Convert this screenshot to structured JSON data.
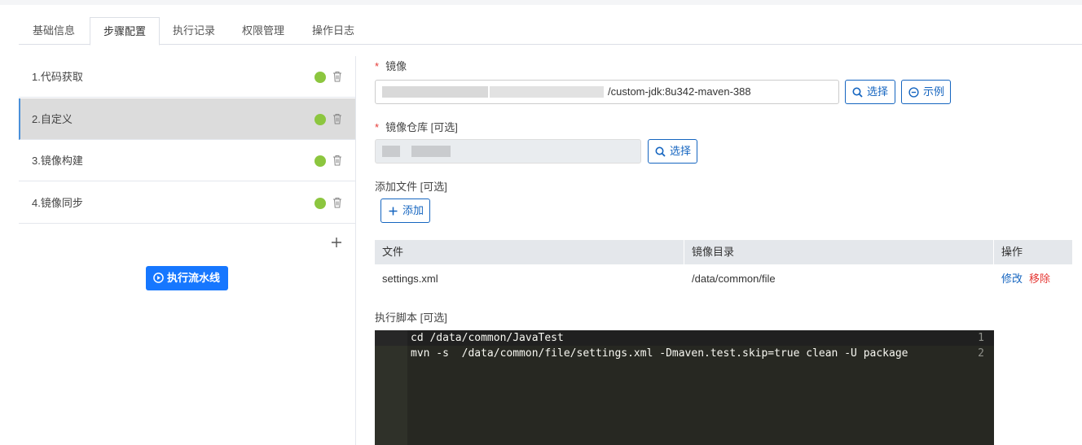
{
  "tabs": [
    {
      "label": "基础信息"
    },
    {
      "label": "步骤配置",
      "active": true
    },
    {
      "label": "执行记录"
    },
    {
      "label": "权限管理"
    },
    {
      "label": "操作日志"
    }
  ],
  "steps": [
    {
      "label": "1.代码获取",
      "status_color": "#8cc63f"
    },
    {
      "label": "2.自定义",
      "status_color": "#8cc63f",
      "active": true
    },
    {
      "label": "3.镜像构建",
      "status_color": "#8cc63f"
    },
    {
      "label": "4.镜像同步",
      "status_color": "#8cc63f"
    }
  ],
  "run_button": {
    "label": "执行流水线",
    "icon": "play-circle-icon"
  },
  "image_field": {
    "required_mark": "*",
    "label": "镜像",
    "value": "/custom-jdk:8u342-maven-388",
    "select_label": "选择",
    "example_label": "示例"
  },
  "repo_field": {
    "required_mark": "*",
    "label": "镜像仓库 [可选]",
    "select_label": "选择"
  },
  "add_file": {
    "label": "添加文件 [可选]",
    "add_label": "添加"
  },
  "file_table": {
    "headers": [
      "文件",
      "镜像目录",
      "操作"
    ],
    "rows": [
      {
        "file": "settings.xml",
        "dir": "/data/common/file",
        "edit": "修改",
        "remove": "移除"
      }
    ]
  },
  "script": {
    "label": "执行脚本 [可选]",
    "lines": [
      {
        "num": "1",
        "code": "cd /data/common/JavaTest"
      },
      {
        "num": "2",
        "code": "mvn -s  /data/common/file/settings.xml -Dmaven.test.skip=true clean -U package"
      }
    ]
  },
  "colors": {
    "accent": "#1677ff",
    "link": "#1565c0",
    "danger": "#e53935",
    "status_ok": "#8cc63f",
    "editor_bg": "#272822"
  }
}
